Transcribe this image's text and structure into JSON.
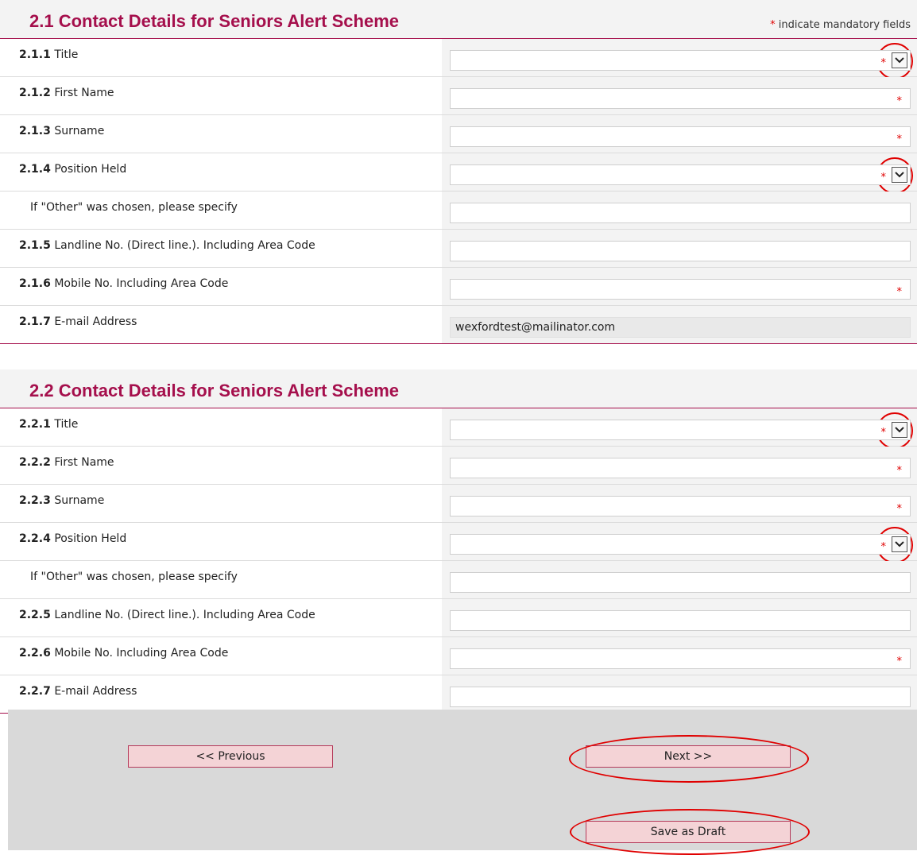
{
  "section1": {
    "title": "2.1 Contact Details for Seniors Alert Scheme",
    "mandatory_star": "*",
    "mandatory_note": "indicate mandatory fields",
    "rows": [
      {
        "num": "2.1.1",
        "label": "Title",
        "value": "",
        "required": true,
        "dropdown": true
      },
      {
        "num": "2.1.2",
        "label": "First Name",
        "value": "",
        "required": true,
        "dropdown": false
      },
      {
        "num": "2.1.3",
        "label": "Surname",
        "value": "",
        "required": true,
        "dropdown": false
      },
      {
        "num": "2.1.4",
        "label": "Position Held",
        "value": "",
        "required": true,
        "dropdown": true
      },
      {
        "num": "",
        "label": "If \"Other\" was chosen, please specify",
        "value": "",
        "required": false,
        "dropdown": false
      },
      {
        "num": "2.1.5",
        "label": "Landline No. (Direct line.). Including Area Code",
        "value": "",
        "required": false,
        "dropdown": false
      },
      {
        "num": "2.1.6",
        "label": "Mobile No. Including Area Code",
        "value": "",
        "required": true,
        "dropdown": false
      },
      {
        "num": "2.1.7",
        "label": "E-mail Address",
        "value": "wexfordtest@mailinator.com",
        "required": false,
        "dropdown": false,
        "readonly": true
      }
    ]
  },
  "section2": {
    "title": "2.2 Contact Details for Seniors Alert Scheme",
    "rows": [
      {
        "num": "2.2.1",
        "label": "Title",
        "value": "",
        "required": true,
        "dropdown": true
      },
      {
        "num": "2.2.2",
        "label": "First Name",
        "value": "",
        "required": true,
        "dropdown": false
      },
      {
        "num": "2.2.3",
        "label": "Surname",
        "value": "",
        "required": true,
        "dropdown": false
      },
      {
        "num": "2.2.4",
        "label": "Position Held",
        "value": "",
        "required": true,
        "dropdown": true
      },
      {
        "num": "",
        "label": "If \"Other\" was chosen, please specify",
        "value": "",
        "required": false,
        "dropdown": false
      },
      {
        "num": "2.2.5",
        "label": "Landline No. (Direct line.). Including Area Code",
        "value": "",
        "required": false,
        "dropdown": false
      },
      {
        "num": "2.2.6",
        "label": "Mobile No. Including Area Code",
        "value": "",
        "required": true,
        "dropdown": false
      },
      {
        "num": "2.2.7",
        "label": "E-mail Address",
        "value": "",
        "required": false,
        "dropdown": false
      }
    ]
  },
  "required_marker": "*",
  "buttons": {
    "previous": "<< Previous",
    "next": "Next >>",
    "save_draft": "Save as Draft"
  },
  "colors": {
    "title": "#a50f4c",
    "required": "#e00000",
    "button_bg": "#f4d3d6",
    "annotation_circle": "#e00000"
  }
}
